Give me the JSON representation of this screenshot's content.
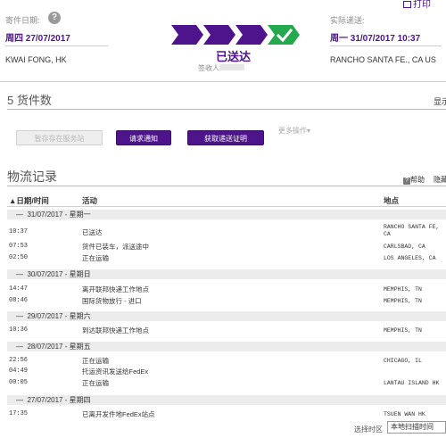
{
  "header": {
    "print_label": "打印",
    "ship_date_label": "寄件日期:",
    "ship_date_value": "周四 27/07/2017",
    "origin": "KWAI FONG, HK",
    "status": "已送达",
    "signed_by_label": "签收人:",
    "actual_delivery_label": "实际递送:",
    "actual_delivery_value": "周一 31/07/2017 10:37",
    "destination": "RANCHO SANTA FE., CA US"
  },
  "pieces": {
    "title": "5 货件数",
    "right_cut": "显示",
    "buttons": {
      "hold": "暂存存在服务站",
      "request_notice": "请求通知",
      "get_proof": "获取递送证明",
      "more_actions": "更多操作"
    }
  },
  "logistics": {
    "title": "物流记录",
    "help": "帮助",
    "hide_cut": "隐藏",
    "columns": {
      "datetime": "日期/时间",
      "activity": "活动",
      "location": "地点"
    },
    "groups": [
      {
        "date": "31/07/2017 - 星期一",
        "events": [
          {
            "time": "10:37",
            "activity": "已送达",
            "location": "RANCHO SANTA FE,",
            "location2": "CA"
          },
          {
            "time": "07:53",
            "activity": "货件已装车，派送途中",
            "location": "CARLSBAD, CA"
          },
          {
            "time": "02:50",
            "activity": "正在运输",
            "location": "LOS ANGELES, CA"
          }
        ]
      },
      {
        "date": "30/07/2017 - 星期日",
        "events": [
          {
            "time": "14:47",
            "activity": "离开联邦快递工作地点",
            "location": "MEMPHIS, TN"
          },
          {
            "time": "08:46",
            "activity": "国际货物放行 - 进口",
            "location": "MEMPHIS, TN"
          }
        ]
      },
      {
        "date": "29/07/2017 - 星期六",
        "events": [
          {
            "time": "10:36",
            "activity": "到达联邦快递工作地点",
            "location": "MEMPHIS, TN"
          }
        ]
      },
      {
        "date": "28/07/2017 - 星期五",
        "events": [
          {
            "time": "22:56",
            "activity": "正在运输",
            "location": "CHICAGO, IL"
          },
          {
            "time": "04:49",
            "activity": "托运资讯发送给FedEx",
            "location": ""
          },
          {
            "time": "00:05",
            "activity": "正在运输",
            "location": "LANTAU ISLAND HK"
          }
        ]
      },
      {
        "date": "27/07/2017 - 星期四",
        "events": [
          {
            "time": "17:35",
            "activity": "已离开发件地FedEx站点",
            "location": "TSUEN WAN HK"
          }
        ]
      }
    ],
    "timezone_label": "选择时区",
    "timezone_value": "本地扫描时间"
  },
  "colors": {
    "brand_purple": "#4d148c",
    "check_green": "#24a94f"
  },
  "progress_steps": 4,
  "progress_completed": 4
}
